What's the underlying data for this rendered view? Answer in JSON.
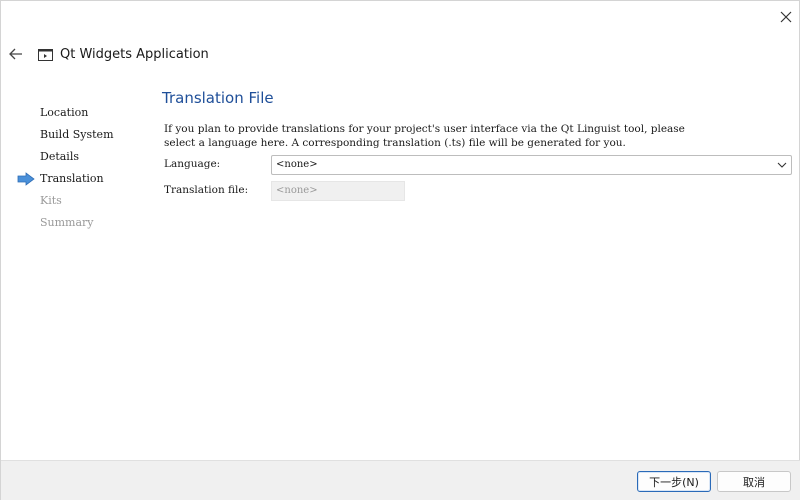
{
  "window": {
    "title": "Qt Widgets Application"
  },
  "steps": [
    {
      "label": "Location",
      "state": "done"
    },
    {
      "label": "Build System",
      "state": "done"
    },
    {
      "label": "Details",
      "state": "done"
    },
    {
      "label": "Translation",
      "state": "current"
    },
    {
      "label": "Kits",
      "state": "disabled"
    },
    {
      "label": "Summary",
      "state": "disabled"
    }
  ],
  "page": {
    "title": "Translation File",
    "description_line1": "If you plan to provide translations for your project's user interface via the Qt Linguist tool, please",
    "description_line2": "select a language here. A corresponding translation (.ts) file will be generated for you.",
    "language_label": "Language:",
    "language_value": "<none>",
    "translation_file_label": "Translation file:",
    "translation_file_value": "<none>"
  },
  "footer": {
    "next_label": "下一步(N)",
    "cancel_label": "取消"
  },
  "colors": {
    "accent": "#1f4f99",
    "arrow": "#4a90d9"
  }
}
